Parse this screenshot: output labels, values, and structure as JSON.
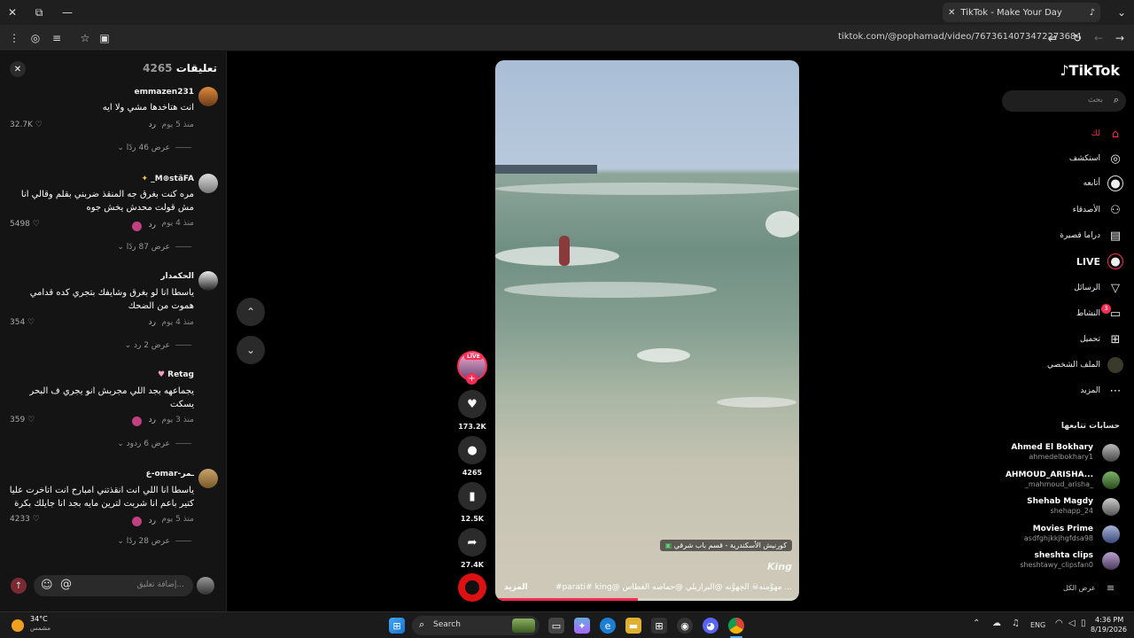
{
  "browser": {
    "tab_title": "TikTok - Make Your Day",
    "url": "tiktok.com/@pophamad/video/7673614073472273684"
  },
  "comments": {
    "header_label": "تعليقات",
    "count": "4265",
    "items": [
      {
        "user": "emmazen231",
        "text": "انت هتاخدها مشي ولا ايه",
        "time": "منذ 5 يوم",
        "reply": "رد",
        "likes": "32.7K",
        "view_replies": "عرض 46 ردًا"
      },
      {
        "user": "_M⊕stăFA",
        "text": "مره كنت بغرق جه المنقذ ضربني بقلم وقالي انا مش قولت محدش يخش جوه",
        "time": "منذ 4 يوم",
        "reply": "رد",
        "likes": "5498",
        "view_replies": "عرض 87 ردًا"
      },
      {
        "user": "الحكمدار",
        "text": "ياسطا انا لو بغرق وشايفك بتجري كده قدامي هموت من الضحك",
        "time": "منذ 4 يوم",
        "reply": "رد",
        "likes": "354",
        "view_replies": "عرض 2 رد"
      },
      {
        "user": "Retag",
        "text": "يجماعهه بجد اللي مجربش انو يجري ف البحر يسكت",
        "time": "منذ 3 يوم",
        "reply": "رد",
        "likes": "359",
        "view_replies": "عرض 6 ردود"
      },
      {
        "user": "ع-omar-ـمر",
        "text": "ياسطا انا اللي انت انقذتني امبارح انت اتاخرت عليا كتير باعم انا شربت لترين مايه بجد انا جايلك بكرة",
        "time": "منذ 5 يوم",
        "reply": "رد",
        "likes": "4233",
        "view_replies": "عرض 28 ردًا"
      }
    ],
    "add_comment_placeholder": "إضافة تعليق..."
  },
  "video": {
    "location_tag": "كورنيش الأسكندرية - قسم باب شرقي",
    "watermark": "King",
    "caption": "#parati# king@ مهوَّمنه☠ أَلحِهوَّنه @البرازيلي @حماصه الغطاس ...",
    "more": "المزيد",
    "progress": 0.47
  },
  "actions": {
    "live_badge": "LIVE",
    "likes": "173.2K",
    "comments": "4265",
    "saves": "12.5K",
    "shares": "27.4K"
  },
  "sidebar": {
    "logo": "TikTok",
    "search_placeholder": "بحث",
    "nav": [
      {
        "label": "لك",
        "icon": "home-icon"
      },
      {
        "label": "استكشف",
        "icon": "compass-icon"
      },
      {
        "label": "أتابعه",
        "icon": "following-icon"
      },
      {
        "label": "الأصدقاء",
        "icon": "friends-icon"
      },
      {
        "label": "دراما قصيرة",
        "icon": "film-icon"
      },
      {
        "label": "LIVE",
        "icon": "live-icon"
      },
      {
        "label": "الرسائل",
        "icon": "send-icon"
      },
      {
        "label": "النشاط",
        "icon": "activity-icon"
      },
      {
        "label": "تحميل",
        "icon": "upload-icon"
      },
      {
        "label": "الملف الشخصي",
        "icon": "profile-icon"
      },
      {
        "label": "المزيد",
        "icon": "more-icon"
      }
    ],
    "activity_badge": "3",
    "following_header": "حسابات تتابعها",
    "accounts": [
      {
        "name": "Ahmed El Bokhary",
        "handle": "ahmedelbokhary1"
      },
      {
        "name": "AHMOUD_ARISHA...",
        "handle": "_mahmoud_arisha_"
      },
      {
        "name": "Shehab Magdy",
        "handle": "shehapp_24"
      },
      {
        "name": "Movies Prime",
        "handle": "asdfghjkkjhgfdsa98"
      },
      {
        "name": "sheshta clips",
        "handle": "sheshtawy_clipsfan0"
      }
    ],
    "see_all": "عرض الكل"
  },
  "taskbar": {
    "weather_temp": "34°C",
    "weather_desc": "مشمس",
    "search_label": "Search",
    "lang": "ENG",
    "time": "4:36 PM",
    "date": "8/19/2026"
  }
}
